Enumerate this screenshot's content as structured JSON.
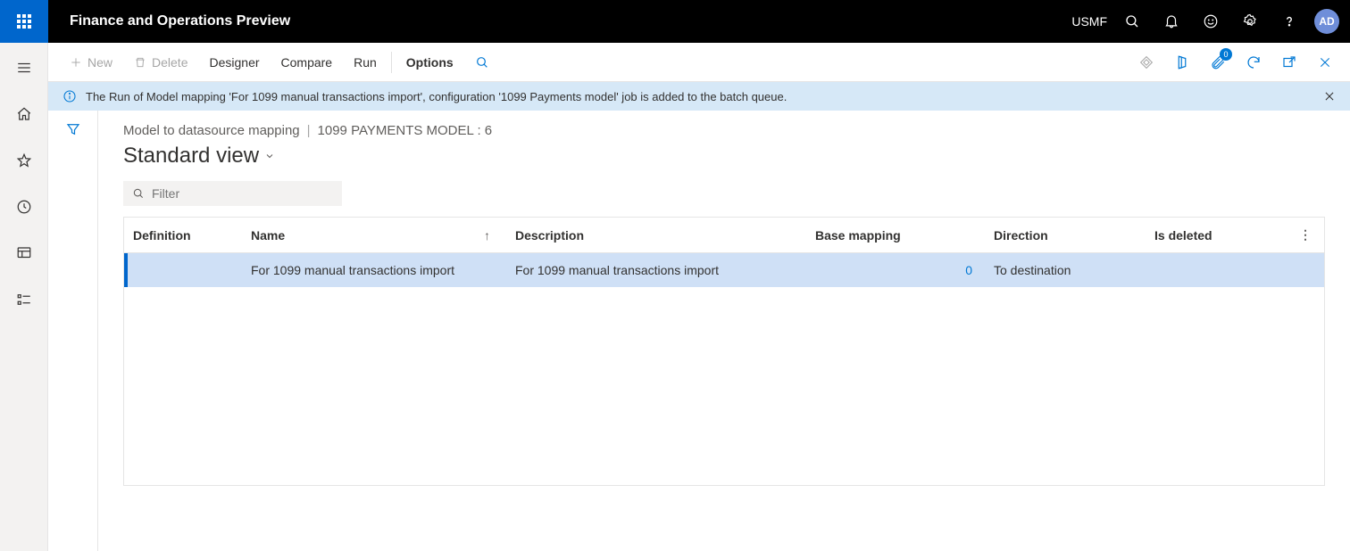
{
  "header": {
    "app_title": "Finance and Operations Preview",
    "company": "USMF",
    "avatar": "AD"
  },
  "actionbar": {
    "new": "New",
    "delete": "Delete",
    "designer": "Designer",
    "compare": "Compare",
    "run": "Run",
    "options": "Options",
    "attach_count": "0"
  },
  "banner": {
    "message": "The Run of Model mapping 'For 1099 manual transactions import', configuration '1099 Payments model' job is added to the batch queue."
  },
  "page": {
    "breadcrumb1": "Model to datasource mapping",
    "breadcrumb2": "1099 PAYMENTS MODEL : 6",
    "view_title": "Standard view",
    "filter_placeholder": "Filter"
  },
  "grid": {
    "columns": {
      "definition": "Definition",
      "name": "Name",
      "description": "Description",
      "base": "Base mapping",
      "direction": "Direction",
      "deleted": "Is deleted"
    },
    "row": {
      "definition": "",
      "name": "For 1099 manual transactions import",
      "description": "For 1099 manual transactions import",
      "base": "0",
      "direction": "To destination",
      "deleted": ""
    }
  }
}
